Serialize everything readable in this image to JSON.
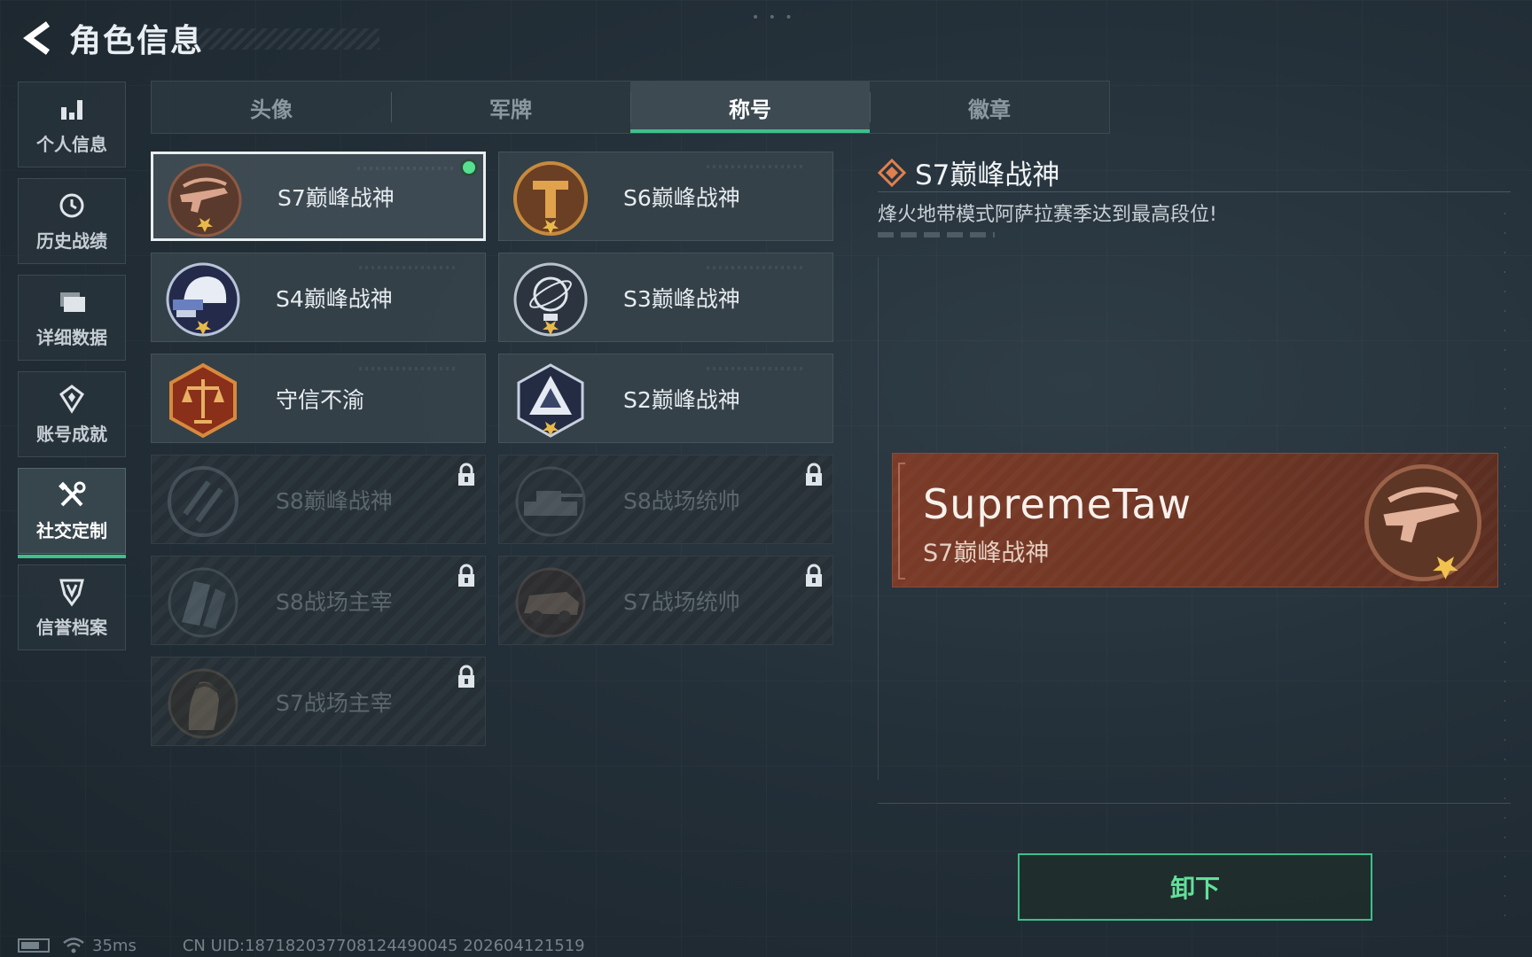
{
  "header": {
    "title": "角色信息"
  },
  "sidebar": {
    "items": [
      {
        "label": "个人信息",
        "icon": "bar-chart-icon"
      },
      {
        "label": "历史战绩",
        "icon": "history-icon"
      },
      {
        "label": "详细数据",
        "icon": "folder-icon"
      },
      {
        "label": "账号成就",
        "icon": "achievement-icon"
      },
      {
        "label": "社交定制",
        "icon": "tools-icon",
        "active": true
      },
      {
        "label": "信誉档案",
        "icon": "shield-icon"
      }
    ]
  },
  "tabs": [
    {
      "label": "头像"
    },
    {
      "label": "军牌"
    },
    {
      "label": "称号",
      "active": true
    },
    {
      "label": "徽章"
    }
  ],
  "titles": [
    {
      "name": "S7巅峰战神",
      "icon": "rifle-badge-icon",
      "selected": true,
      "equipped": true,
      "locked": false
    },
    {
      "name": "S6巅峰战神",
      "icon": "t-shield-badge-icon",
      "locked": false
    },
    {
      "name": "S4巅峰战神",
      "icon": "helmet-badge-icon",
      "locked": false
    },
    {
      "name": "S3巅峰战神",
      "icon": "globe-badge-icon",
      "locked": false
    },
    {
      "name": "守信不渝",
      "icon": "scales-badge-icon",
      "locked": false
    },
    {
      "name": "S2巅峰战神",
      "icon": "triangle-badge-icon",
      "locked": false
    },
    {
      "name": "S8巅峰战神",
      "icon": "slash-badge-icon",
      "locked": true
    },
    {
      "name": "S8战场统帅",
      "icon": "tank-badge-icon",
      "locked": true
    },
    {
      "name": "S8战场主宰",
      "icon": "building-badge-icon",
      "locked": true
    },
    {
      "name": "S7战场统帅",
      "icon": "vehicle-badge-icon",
      "locked": true
    },
    {
      "name": "S7战场主宰",
      "icon": "soldier-badge-icon",
      "locked": true
    }
  ],
  "detail": {
    "title": "S7巅峰战神",
    "description": "烽火地带模式阿萨拉赛季达到最高段位!",
    "preview": {
      "player_name": "SupremeTaw",
      "title": "S7巅峰战神"
    }
  },
  "actions": {
    "unequip_label": "卸下"
  },
  "status_bar": {
    "ping": "35ms",
    "uid": "CN UID:18718203770812449004​5 202604121519"
  },
  "colors": {
    "accent_green": "#3fbf8a",
    "equipped_dot": "#56e08f",
    "nameplate_bg": "#7a3a27",
    "detail_diamond": "#e0804e"
  }
}
